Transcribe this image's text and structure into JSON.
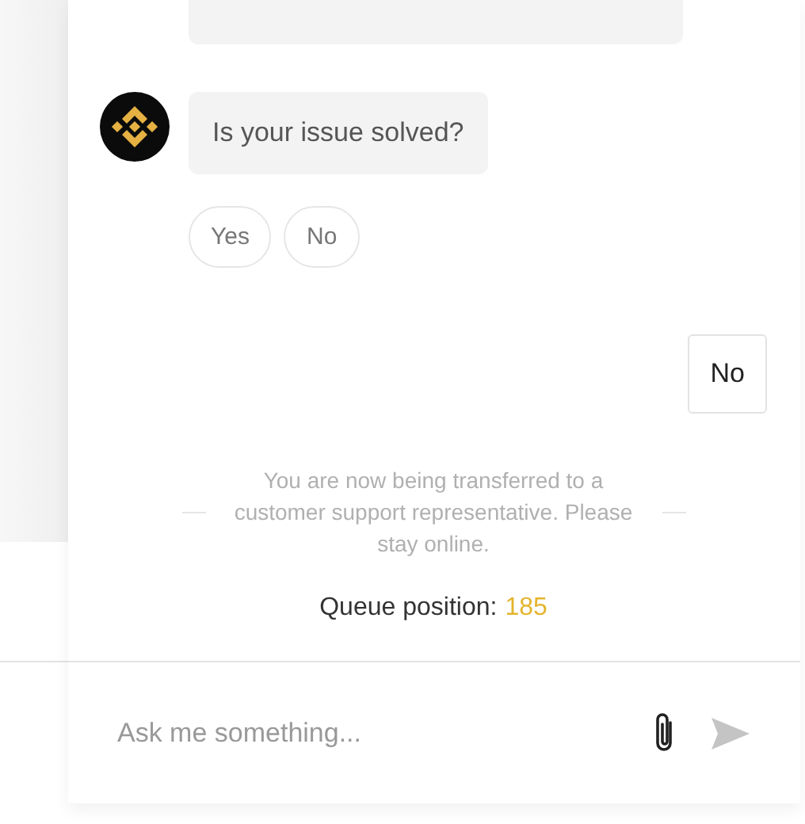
{
  "messages": [
    {
      "kind": "bot_partial"
    },
    {
      "kind": "bot",
      "text": "Is your issue solved?",
      "quick_replies": [
        "Yes",
        "No"
      ]
    },
    {
      "kind": "user",
      "text": "No"
    },
    {
      "kind": "notice",
      "text": "You are now being transferred to a customer support representative. Please stay online."
    },
    {
      "kind": "queue",
      "label": "Queue position:",
      "value": "185"
    }
  ],
  "composer": {
    "placeholder": "Ask me something..."
  }
}
